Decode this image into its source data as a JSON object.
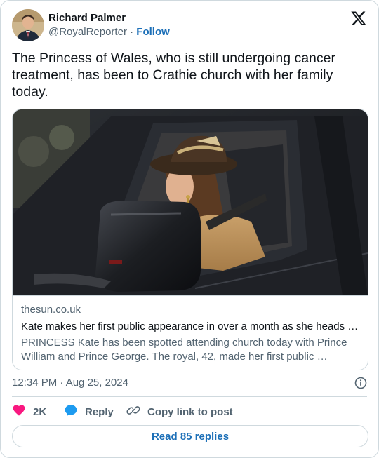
{
  "author": {
    "name": "Richard Palmer",
    "handle": "@RoyalReporter",
    "separator": "·",
    "follow_label": "Follow"
  },
  "tweet": {
    "text": "The Princess of Wales, who is still undergoing cancer treatment, has been to Crathie church with her family today.",
    "timestamp": "12:34 PM · Aug 25, 2024"
  },
  "card": {
    "domain": "thesun.co.uk",
    "title": "Kate makes her first public appearance in over a month as she heads t…",
    "description": "PRINCESS Kate has been spotted attending church today with Prince William and Prince George. The royal, 42, made her first public …"
  },
  "actions": {
    "like_count": "2K",
    "reply_label": "Reply",
    "copy_label": "Copy link to post"
  },
  "read_replies_label": "Read 85 replies",
  "icons": {
    "logo": "x-logo-icon",
    "info": "info-icon",
    "like": "heart-icon",
    "reply": "speech-bubble-icon",
    "copy": "link-icon"
  },
  "colors": {
    "link": "#1d70b8",
    "like": "#f91880",
    "reply": "#1d9bf0",
    "secondary_text": "#536471",
    "border": "#cfd9de"
  }
}
